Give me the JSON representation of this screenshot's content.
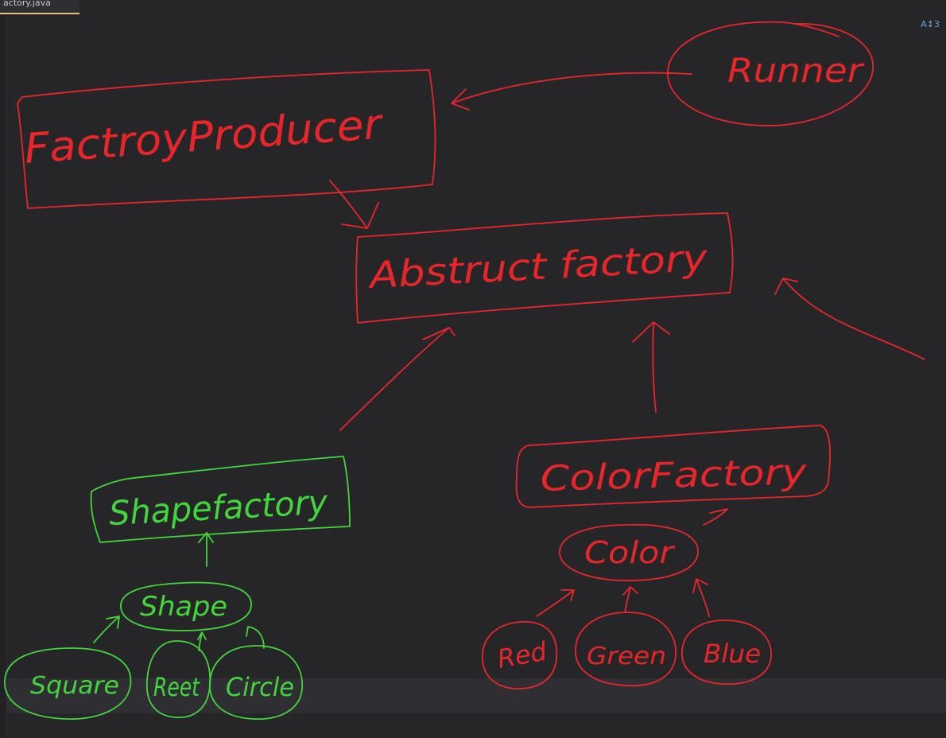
{
  "colors": {
    "background": "#262629",
    "red_ink": "#e8262a",
    "green_ink": "#42d63c"
  },
  "editor": {
    "tab_label": "actory.java",
    "indicator": "A↕3"
  },
  "diagram": {
    "nodes": {
      "runner": "Runner",
      "factory_producer": "FactroyProducer",
      "abstract_factory": "Abstruct factory",
      "shape_factory": "Shapefactory",
      "color_factory": "ColorFactory",
      "shape": "Shape",
      "color": "Color",
      "square": "Square",
      "rect": "Reet",
      "circle": "Circle",
      "red": "Red",
      "green": "Green",
      "blue": "Blue"
    }
  }
}
